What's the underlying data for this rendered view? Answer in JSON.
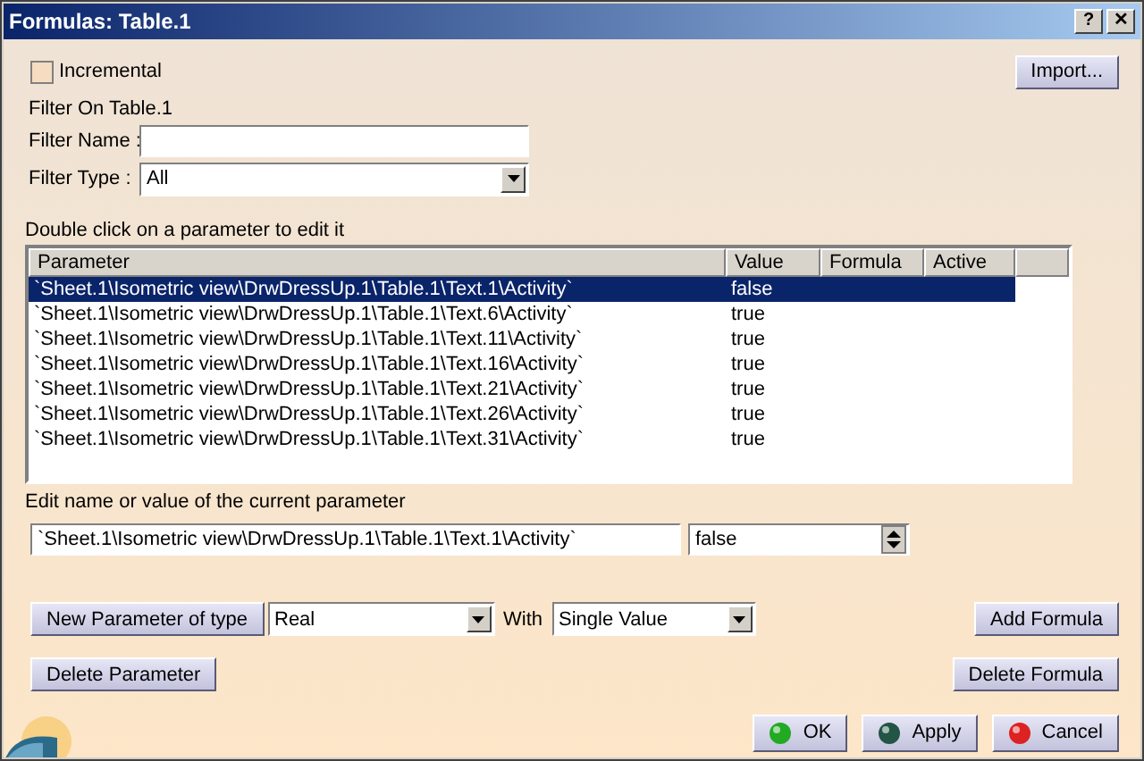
{
  "window": {
    "title": "Formulas: Table.1",
    "help": "?",
    "close": "✕"
  },
  "incremental": {
    "label": "Incremental",
    "checked": false
  },
  "import_button": "Import...",
  "filter_on": "Filter On Table.1",
  "filter_name": {
    "label": "Filter Name :"
  },
  "filter_type": {
    "label": "Filter Type :",
    "value": "All"
  },
  "table_hint": "Double click on a parameter to edit it",
  "table": {
    "columns": [
      "Parameter",
      "Value",
      "Formula",
      "Active"
    ],
    "rows": [
      {
        "parameter": "`Sheet.1\\Isometric view\\DrwDressUp.1\\Table.1\\Text.1\\Activity`",
        "value": "false",
        "selected": true
      },
      {
        "parameter": "`Sheet.1\\Isometric view\\DrwDressUp.1\\Table.1\\Text.6\\Activity`",
        "value": "true",
        "selected": false
      },
      {
        "parameter": "`Sheet.1\\Isometric view\\DrwDressUp.1\\Table.1\\Text.11\\Activity`",
        "value": "true",
        "selected": false
      },
      {
        "parameter": "`Sheet.1\\Isometric view\\DrwDressUp.1\\Table.1\\Text.16\\Activity`",
        "value": "true",
        "selected": false
      },
      {
        "parameter": "`Sheet.1\\Isometric view\\DrwDressUp.1\\Table.1\\Text.21\\Activity`",
        "value": "true",
        "selected": false
      },
      {
        "parameter": "`Sheet.1\\Isometric view\\DrwDressUp.1\\Table.1\\Text.26\\Activity`",
        "value": "true",
        "selected": false
      },
      {
        "parameter": "`Sheet.1\\Isometric view\\DrwDressUp.1\\Table.1\\Text.31\\Activity`",
        "value": "true",
        "selected": false
      }
    ]
  },
  "edit_hint": "Edit name or value of the current parameter",
  "edit_name": "`Sheet.1\\Isometric view\\DrwDressUp.1\\Table.1\\Text.1\\Activity`",
  "edit_value": "false",
  "new_parameter_button": "New Parameter of type",
  "parameter_type": "Real",
  "with_label": "With",
  "value_kind": "Single Value",
  "add_formula_button": "Add Formula",
  "delete_parameter_button": "Delete Parameter",
  "delete_formula_button": "Delete Formula",
  "dialog_buttons": [
    {
      "label": "OK",
      "color": "#22aa22"
    },
    {
      "label": "Apply",
      "color": "#225544"
    },
    {
      "label": "Cancel",
      "color": "#dd2222"
    }
  ]
}
